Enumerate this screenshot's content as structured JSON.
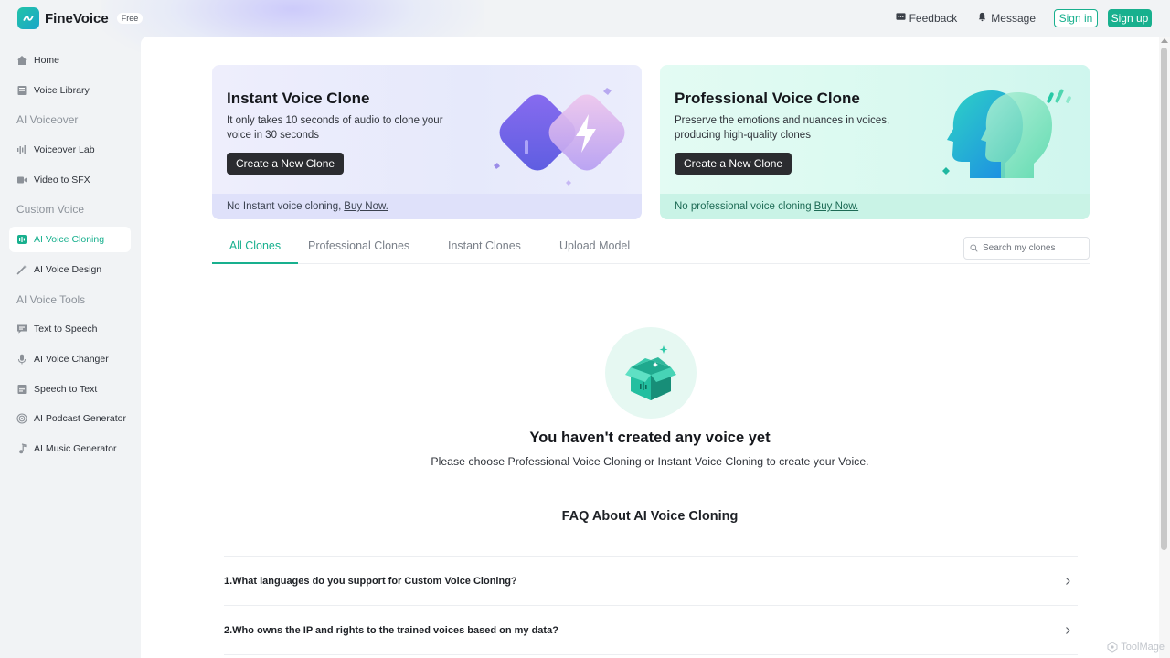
{
  "app": {
    "name": "FineVoice",
    "plan_badge": "Free"
  },
  "header": {
    "feedback": "Feedback",
    "message": "Message",
    "sign_in": "Sign in",
    "sign_up": "Sign up"
  },
  "sidebar": {
    "items": [
      {
        "type": "item",
        "label": "Home",
        "icon": "home-icon"
      },
      {
        "type": "item",
        "label": "Voice Library",
        "icon": "library-icon"
      },
      {
        "type": "section",
        "label": "AI Voiceover"
      },
      {
        "type": "item",
        "label": "Voiceover Lab",
        "icon": "waveform-icon"
      },
      {
        "type": "item",
        "label": "Video to SFX",
        "icon": "video-icon"
      },
      {
        "type": "section",
        "label": "Custom Voice"
      },
      {
        "type": "item",
        "label": "AI Voice Cloning",
        "icon": "voice-clone-icon",
        "active": true
      },
      {
        "type": "item",
        "label": "AI Voice Design",
        "icon": "magic-wand-icon"
      },
      {
        "type": "section",
        "label": "AI Voice Tools"
      },
      {
        "type": "item",
        "label": "Text to Speech",
        "icon": "text-speech-icon"
      },
      {
        "type": "item",
        "label": "AI Voice Changer",
        "icon": "microphone-icon"
      },
      {
        "type": "item",
        "label": "Speech to Text",
        "icon": "document-icon"
      },
      {
        "type": "item",
        "label": "AI Podcast Generator",
        "icon": "podcast-icon"
      },
      {
        "type": "item",
        "label": "AI Music Generator",
        "icon": "music-note-icon"
      }
    ]
  },
  "cards": {
    "instant": {
      "title": "Instant Voice Clone",
      "description": "It only takes 10 seconds of audio to clone your voice in 30 seconds",
      "button": "Create a New Clone",
      "footer_text": "No Instant voice cloning,",
      "footer_link": "Buy Now."
    },
    "professional": {
      "title": "Professional Voice Clone",
      "description": "Preserve the emotions and nuances in voices, producing high-quality clones",
      "button": "Create a New Clone",
      "footer_text": "No professional voice cloning",
      "footer_link": "Buy Now."
    }
  },
  "tabs": [
    {
      "label": "All Clones",
      "active": true
    },
    {
      "label": "Professional Clones",
      "active": false
    },
    {
      "label": "Instant Clones",
      "active": false
    },
    {
      "label": "Upload Model",
      "active": false
    }
  ],
  "search": {
    "placeholder": "Search my clones",
    "value": ""
  },
  "empty_state": {
    "title": "You haven't created any voice yet",
    "description": "Please choose Professional Voice Cloning or Instant Voice Cloning to create your Voice."
  },
  "faq": {
    "title": "FAQ About AI Voice Cloning",
    "items": [
      "1.What languages do you support for Custom Voice Cloning?",
      "2.Who owns the IP and rights to the trained voices based on my data?"
    ]
  },
  "watermark": "ToolMage",
  "colors": {
    "accent": "#18b08e",
    "dark_button": "#2b2c30",
    "sidebar_bg": "#f1f3f5"
  }
}
